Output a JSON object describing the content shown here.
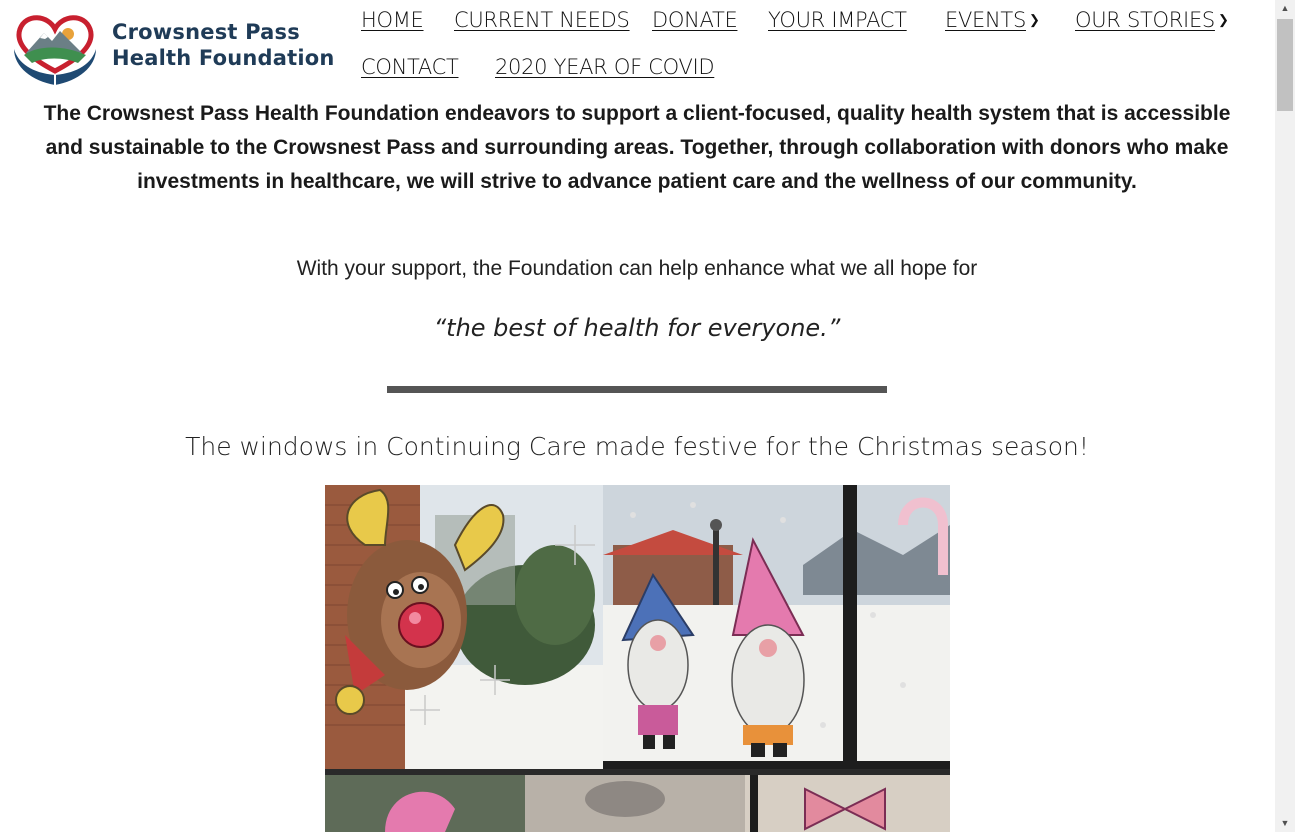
{
  "logo": {
    "line1": "Crowsnest Pass",
    "line2": "Health Foundation"
  },
  "nav": {
    "items": [
      {
        "label": "HOME"
      },
      {
        "label": "CURRENT NEEDS"
      },
      {
        "label": "DONATE"
      },
      {
        "label": "YOUR IMPACT"
      },
      {
        "label": "EVENTS",
        "has_dropdown": true
      },
      {
        "label": "OUR STORIES",
        "has_dropdown": true
      },
      {
        "label": "CONTACT"
      },
      {
        "label": "2020 YEAR OF COVID"
      }
    ],
    "dropdown_icon": "chevron-down-icon"
  },
  "main": {
    "mission": "The Crowsnest Pass Health Foundation endeavors to support a client-focused, quality health system that is accessible and sustainable to the Crowsnest Pass and surrounding areas. Together, through collaboration with donors who make investments in healthcare, we will strive to advance patient care and the wellness of our community.",
    "support": "With your support, the Foundation can help enhance what we all hope for",
    "quote": "“the best of health for everyone.”",
    "caption": "The windows in Continuing Care made festive for the Christmas season!"
  },
  "colors": {
    "logo_text": "#1f3b57",
    "logo_heart_red": "#c8202f",
    "logo_hands": "#1f4a73",
    "logo_green": "#3f8f4f",
    "divider": "#555555",
    "text": "#1a1a1a"
  }
}
